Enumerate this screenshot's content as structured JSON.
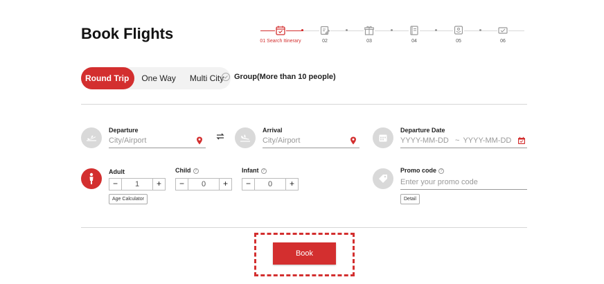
{
  "page": {
    "title": "Book Flights"
  },
  "stepper": {
    "steps": [
      {
        "label": "01 Search Itinerary",
        "icon": "calendar-icon"
      },
      {
        "label": "02",
        "icon": "edit-icon"
      },
      {
        "label": "03",
        "icon": "gift-icon"
      },
      {
        "label": "04",
        "icon": "book-icon"
      },
      {
        "label": "05",
        "icon": "seat-icon"
      },
      {
        "label": "06",
        "icon": "card-icon"
      }
    ]
  },
  "trip_type": {
    "options": [
      "Round Trip",
      "One Way",
      "Multi City"
    ],
    "selected": "Round Trip",
    "group_label": "Group(More than 10 people)"
  },
  "form": {
    "departure": {
      "label": "Departure",
      "placeholder": "City/Airport",
      "icon": "plane-takeoff-icon"
    },
    "arrival": {
      "label": "Arrival",
      "placeholder": "City/Airport",
      "icon": "plane-landing-icon"
    },
    "dates": {
      "label": "Departure Date",
      "start_placeholder": "YYYY-MM-DD",
      "separator": "~",
      "end_placeholder": "YYYY-MM-DD",
      "icon": "calendar-icon"
    },
    "passengers": {
      "adult": {
        "label": "Adult",
        "value": "1"
      },
      "child": {
        "label": "Child",
        "value": "0"
      },
      "infant": {
        "label": "Infant",
        "value": "0"
      },
      "age_calc_label": "Age Calculator",
      "help_glyph": "?",
      "minus_glyph": "−",
      "plus_glyph": "+"
    },
    "promo": {
      "label": "Promo code",
      "placeholder": "Enter your promo code",
      "detail_label": "Detail",
      "icon": "tag-icon"
    }
  },
  "actions": {
    "book_label": "Book"
  },
  "colors": {
    "accent": "#d32f2f",
    "muted": "#d9d9d9"
  }
}
